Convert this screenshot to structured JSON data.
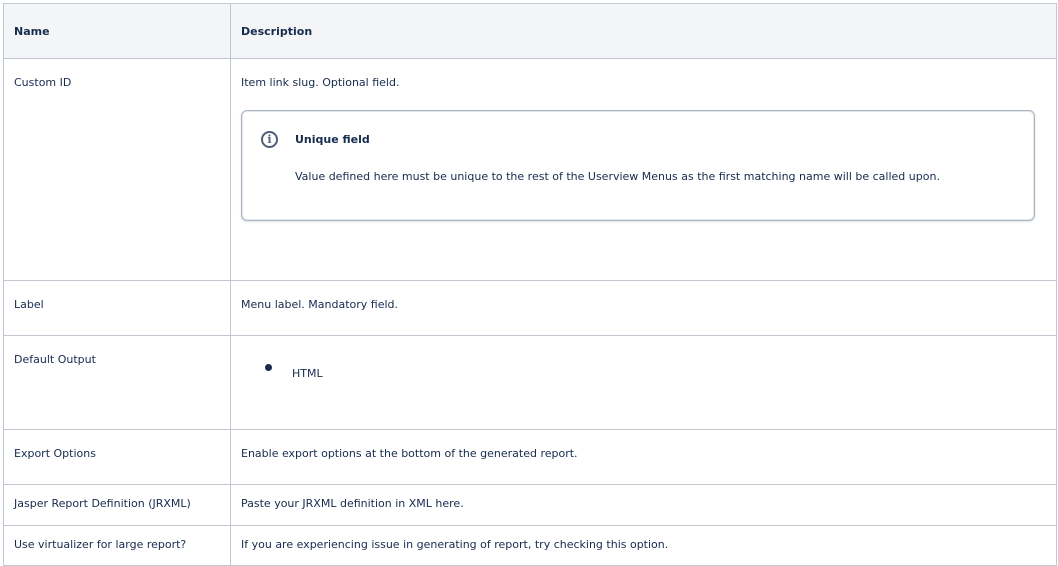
{
  "table": {
    "headers": {
      "name": "Name",
      "description": "Description"
    },
    "rows": {
      "custom_id": {
        "name": "Custom ID",
        "description": "Item link slug. Optional field.",
        "panel": {
          "icon": "info-icon",
          "icon_glyph": "i",
          "title": "Unique field",
          "body": "Value defined here must be unique to the rest of the Userview Menus as the first matching name will be called upon."
        }
      },
      "label": {
        "name": "Label",
        "description": "Menu label. Mandatory field."
      },
      "default_output": {
        "name": "Default Output",
        "bullets": [
          "HTML"
        ]
      },
      "export_options": {
        "name": "Export Options",
        "description": "Enable export options at the bottom of the generated report."
      },
      "jrxml": {
        "name": "Jasper Report Definition (JRXML)",
        "description": "Paste your JRXML definition in XML here."
      },
      "virtualizer": {
        "name": "Use virtualizer for large report?",
        "description": "If you are experiencing issue in generating of report, try checking this option."
      }
    }
  }
}
